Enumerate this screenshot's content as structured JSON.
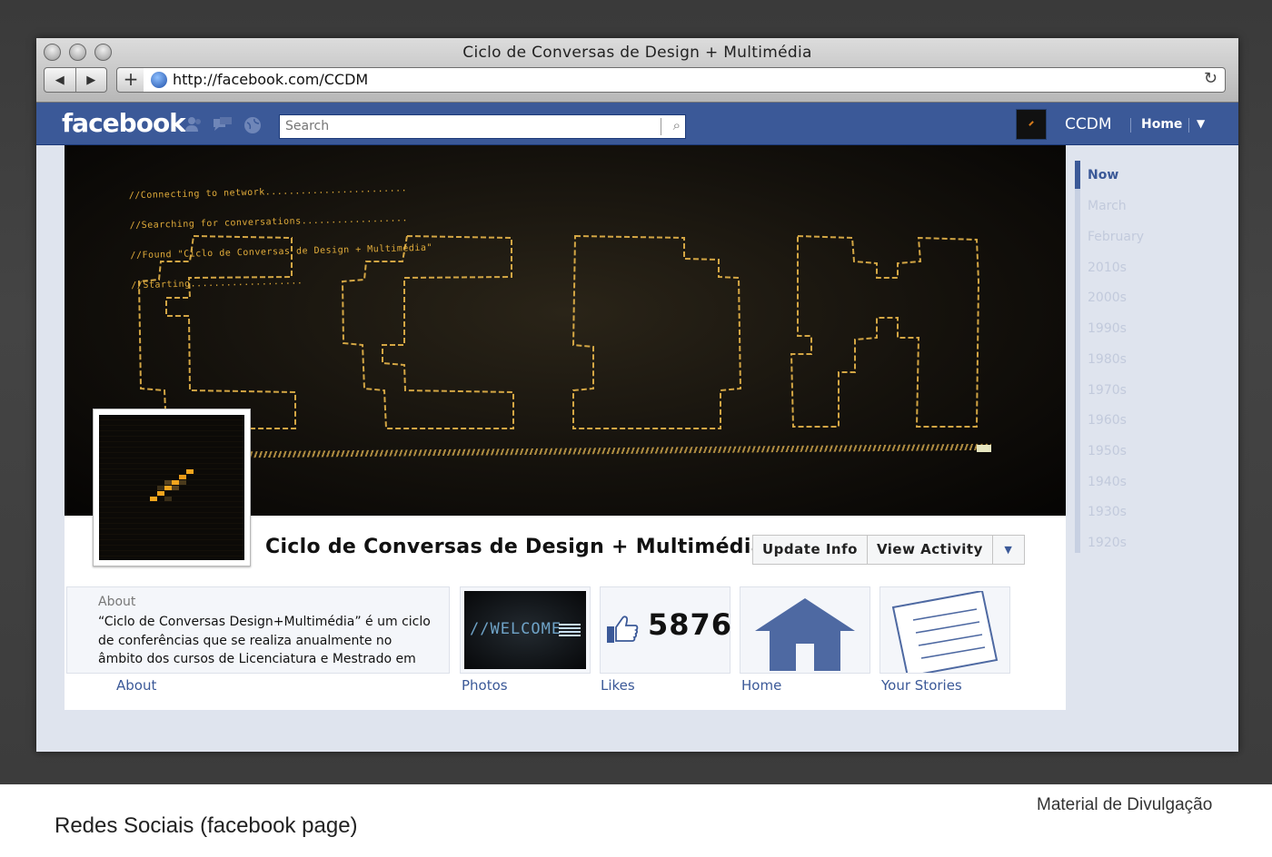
{
  "window": {
    "title": "Ciclo de Conversas de Design + Multimédia",
    "url": "http://facebook.com/CCDM",
    "back_glyph": "◀",
    "forward_glyph": "▶",
    "add_glyph": "+",
    "reload_glyph": "↻"
  },
  "fbbar": {
    "logo": "facebook",
    "search_placeholder": "Search",
    "search_glyph": "⌕",
    "profile_name": "CCDM",
    "home_label": "Home",
    "menu_glyph": "▼",
    "brand_color": "#3b5998"
  },
  "cover": {
    "console_lines": [
      "//Connecting to network........................",
      "//Searching for conversations..................",
      "//Found \"Ciclo de Conversas de Design + Multimédia\"",
      "//Starting..................."
    ],
    "glow_color": "#e0ab3a"
  },
  "profile": {
    "page_title": "Ciclo de Conversas de Design + Multimédia",
    "update_info_label": "Update Info",
    "view_activity_label": "View Activity",
    "more_glyph": "▼"
  },
  "about": {
    "heading": "About",
    "text": "“Ciclo de Conversas Design+Multimédia” é um ciclo de conferências que se realiza anualmente no âmbito dos cursos de Licenciatura e Mestrado em",
    "link_label": "About"
  },
  "tabs": {
    "photos_label": "Photos",
    "photos_thumb_text": "//WELCOME",
    "likes_label": "Likes",
    "likes_count": "5876",
    "home_label": "Home",
    "stories_label": "Your Stories"
  },
  "timeline": [
    "Now",
    "March",
    "February",
    "2010s",
    "2000s",
    "1990s",
    "1980s",
    "1970s",
    "1960s",
    "1950s",
    "1940s",
    "1930s",
    "1920s"
  ],
  "captions": {
    "right": "Material de Divulgação",
    "left": "Redes Sociais (facebook page)"
  }
}
